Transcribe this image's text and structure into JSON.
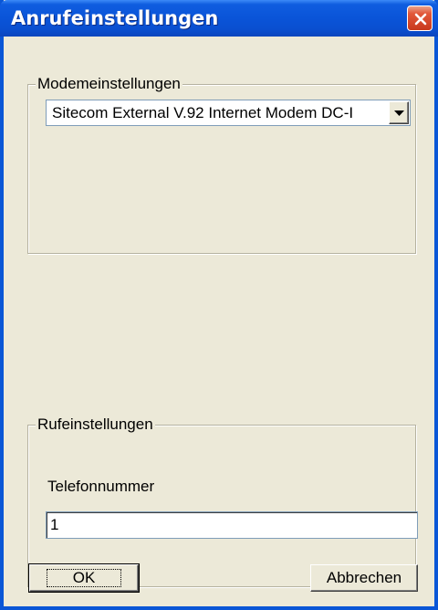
{
  "window": {
    "title": "Anrufeinstellungen"
  },
  "modem_group": {
    "legend": "Modemeinstellungen",
    "selected_modem": "Sitecom External V.92 Internet Modem DC-I"
  },
  "call_group": {
    "legend": "Rufeinstellungen",
    "phone_label": "Telefonnummer",
    "phone_value": "1"
  },
  "buttons": {
    "ok": "OK",
    "cancel": "Abbrechen"
  },
  "icons": {
    "close": "close-icon",
    "dropdown": "chevron-down-icon"
  },
  "colors": {
    "titlebar": "#0a54d8",
    "dialog_bg": "#ece9d8",
    "close_button": "#e2583a"
  }
}
